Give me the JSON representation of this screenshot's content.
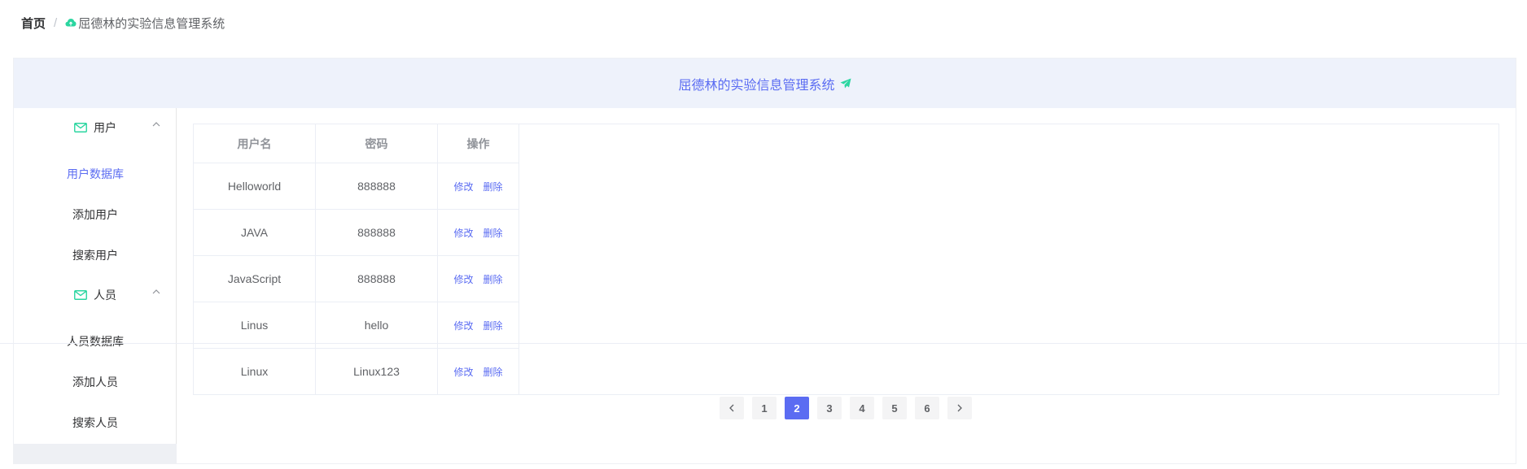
{
  "breadcrumb": {
    "home": "首页",
    "separator": "/",
    "current": "屈德林的实验信息管理系统",
    "icon": "cloud-icon"
  },
  "header": {
    "title": "屈德林的实验信息管理系统",
    "icon": "send-icon"
  },
  "menu": {
    "groups": [
      {
        "title": "用户",
        "icon": "mail-icon",
        "items": [
          "用户数据库",
          "添加用户",
          "搜索用户"
        ],
        "active_index": 0
      },
      {
        "title": "人员",
        "icon": "mail-icon",
        "items": [
          "人员数据库",
          "添加人员",
          "搜索人员"
        ]
      }
    ]
  },
  "table": {
    "headers": [
      "用户名",
      "密码",
      "操作"
    ],
    "rows": [
      {
        "username": "Helloworld",
        "password": "888888"
      },
      {
        "username": "JAVA",
        "password": "888888"
      },
      {
        "username": "JavaScript",
        "password": "888888"
      },
      {
        "username": "Linus",
        "password": "hello"
      },
      {
        "username": "Linux",
        "password": "Linux123"
      }
    ],
    "actions": {
      "edit": "修改",
      "delete": "删除"
    }
  },
  "pagination": {
    "prev": "‹",
    "next": "›",
    "pages": [
      "1",
      "2",
      "3",
      "4",
      "5",
      "6"
    ],
    "current": "2"
  },
  "colors": {
    "accent": "#5b6cf2",
    "header_bg": "#eef2fb",
    "green": "#2bd6a0"
  }
}
